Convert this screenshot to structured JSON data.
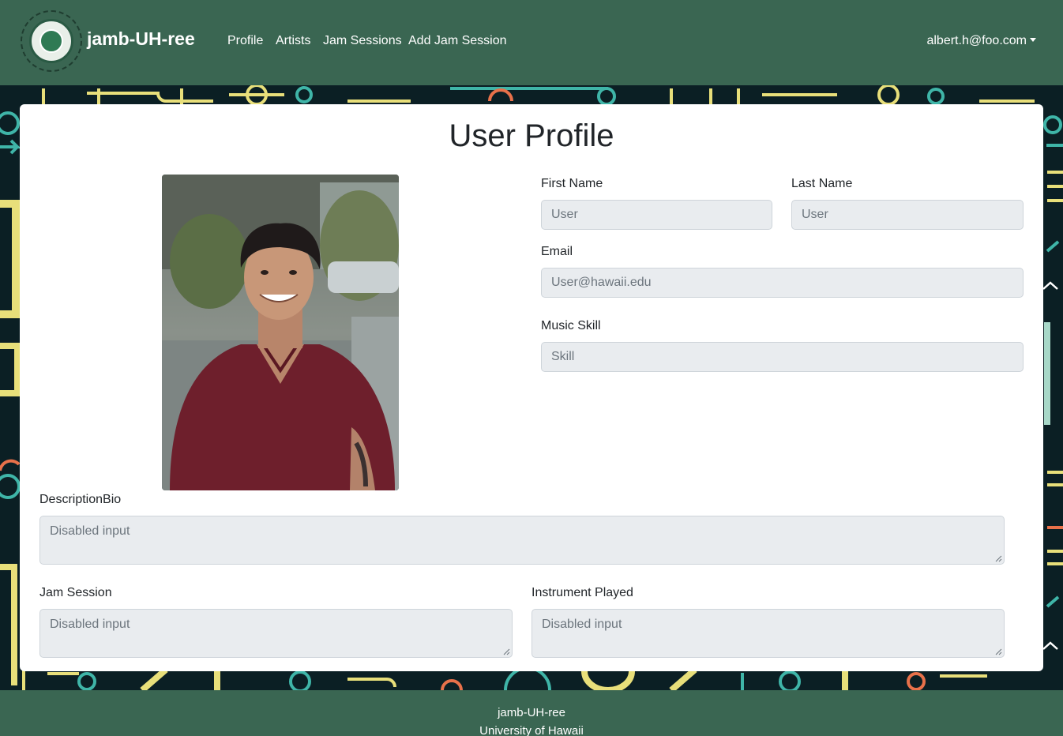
{
  "navbar": {
    "brand": "jamb-UH-ree",
    "links": [
      "Profile",
      "Artists",
      "Jam Sessions",
      "Add Jam Session"
    ],
    "user_email": "albert.h@foo.com"
  },
  "profile": {
    "title": "User Profile",
    "first_name": {
      "label": "First Name",
      "placeholder": "User"
    },
    "last_name": {
      "label": "Last Name",
      "placeholder": "User"
    },
    "email": {
      "label": "Email",
      "placeholder": "User@hawaii.edu"
    },
    "music_skill": {
      "label": "Music Skill",
      "placeholder": "Skill"
    },
    "bio": {
      "label": "DescriptionBio",
      "placeholder": "Disabled input"
    },
    "jam_session": {
      "label": "Jam Session",
      "placeholder": "Disabled input"
    },
    "instrument": {
      "label": "Instrument Played",
      "placeholder": "Disabled input"
    }
  },
  "footer": {
    "line1": "jamb-UH-ree",
    "line2": "University of Hawaii"
  },
  "colors": {
    "navbar": "#3a6652",
    "background": "#0b1f24",
    "input_disabled": "#e9ecef"
  }
}
